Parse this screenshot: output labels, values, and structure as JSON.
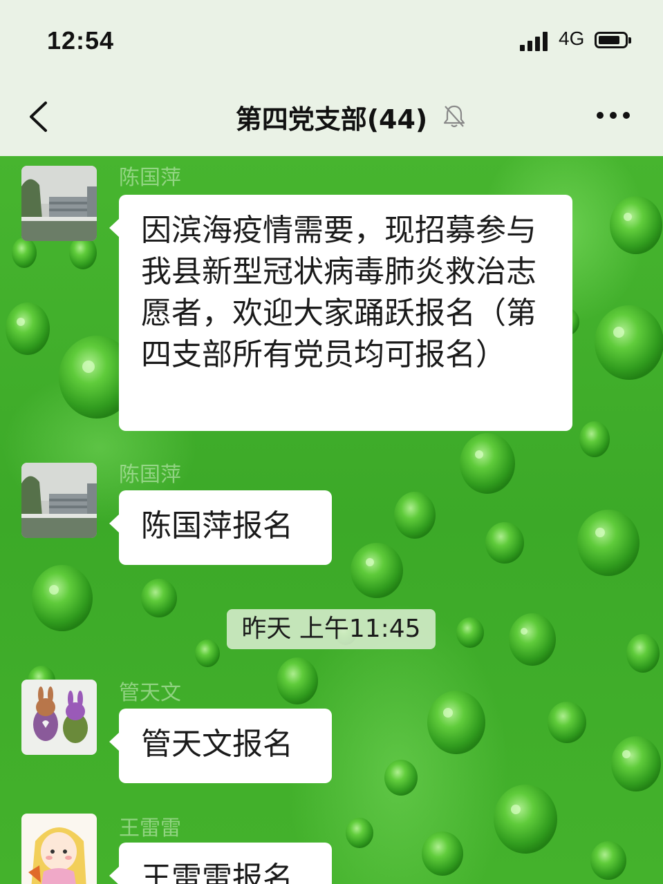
{
  "status_bar": {
    "time": "12:54",
    "network": "4G"
  },
  "header": {
    "title": "第四党支部(44)",
    "icons": [
      "back-chevron-icon",
      "mute-bell-icon",
      "more-dots-icon"
    ]
  },
  "messages": [
    {
      "sender": "陈国萍",
      "text": "因滨海疫情需要，现招募参与我县新型冠状病毒肺炎救治志愿者，欢迎大家踊跃报名（第四支部所有党员均可报名）"
    },
    {
      "sender": "陈国萍",
      "text": "陈国萍报名"
    },
    {
      "sender": "管天文",
      "text": "管天文报名"
    },
    {
      "sender": "王雷雷",
      "text": "王雷雷报名"
    }
  ],
  "timestamp": "昨天 上午11:45",
  "colors": {
    "bar_bg": "#eaf2e6",
    "chat_bg": "#3fae2a",
    "bubble_bg": "#ffffff"
  }
}
